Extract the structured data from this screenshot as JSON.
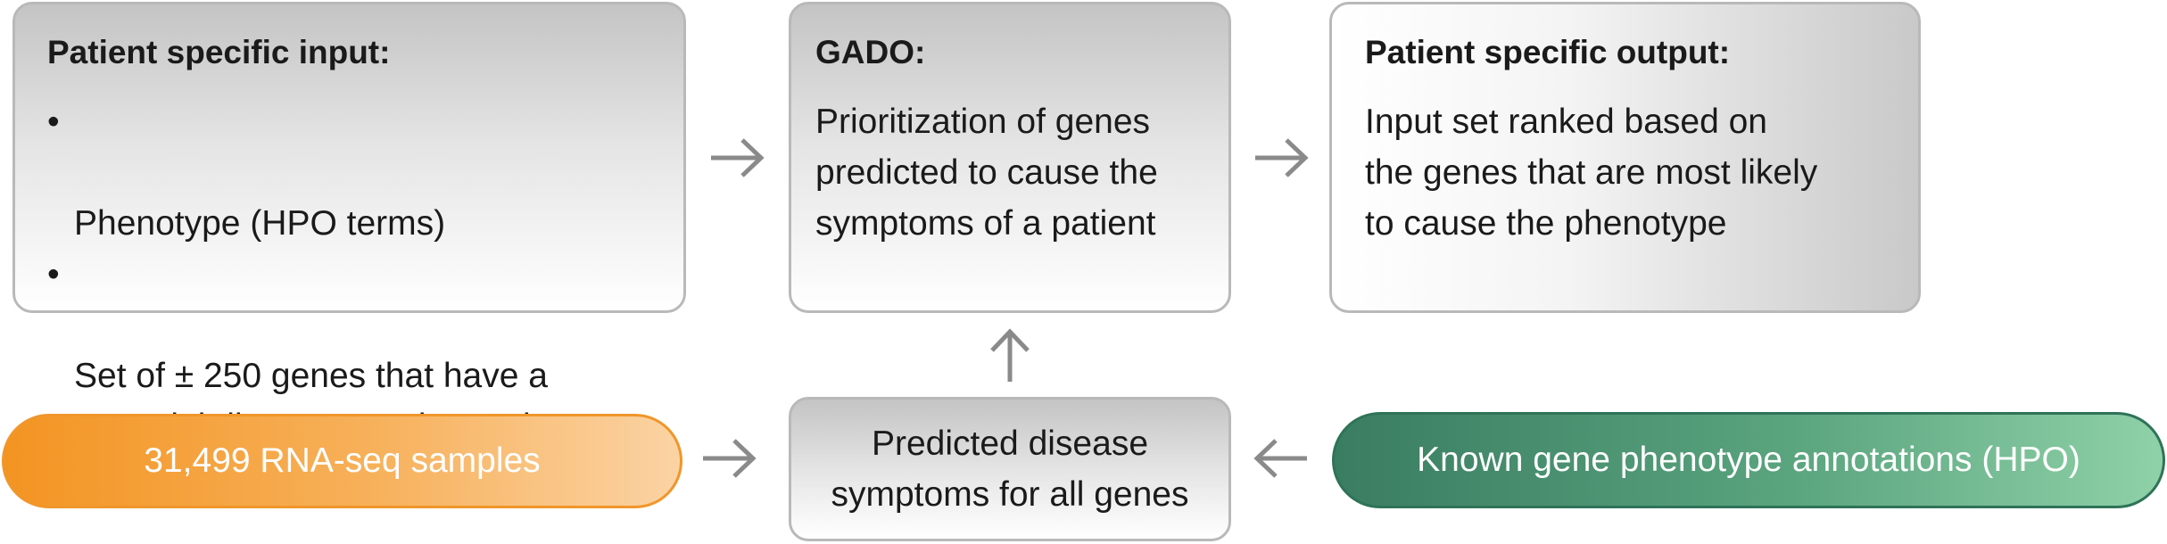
{
  "input_box": {
    "heading": "Patient specific input:",
    "bullets": [
      "Phenotype (HPO terms)",
      "Set of ± 250 genes that have a\npotential disease causing variant"
    ]
  },
  "gado_box": {
    "heading": "GADO:",
    "lines": [
      "Prioritization of genes",
      "predicted to cause the",
      "symptoms of a patient"
    ]
  },
  "output_box": {
    "heading": "Patient specific output:",
    "lines": [
      "Input set ranked based on",
      "the genes that are most likely",
      "to cause the phenotype"
    ]
  },
  "predicted_box": {
    "lines": [
      "Predicted disease",
      "symptoms for all genes"
    ]
  },
  "rna_pill": {
    "label": "31,499 RNA-seq samples",
    "color": "#f39422"
  },
  "known_pill": {
    "label": "Known gene phenotype annotations (HPO)",
    "color": "#3a7d62"
  },
  "arrows": {
    "color": "#8a8a8a",
    "flows": [
      {
        "from": "input_box",
        "to": "gado_box",
        "direction": "right"
      },
      {
        "from": "gado_box",
        "to": "output_box",
        "direction": "right"
      },
      {
        "from": "predicted_box",
        "to": "gado_box",
        "direction": "up"
      },
      {
        "from": "rna_pill",
        "to": "predicted_box",
        "direction": "right"
      },
      {
        "from": "known_pill",
        "to": "predicted_box",
        "direction": "left"
      }
    ]
  }
}
